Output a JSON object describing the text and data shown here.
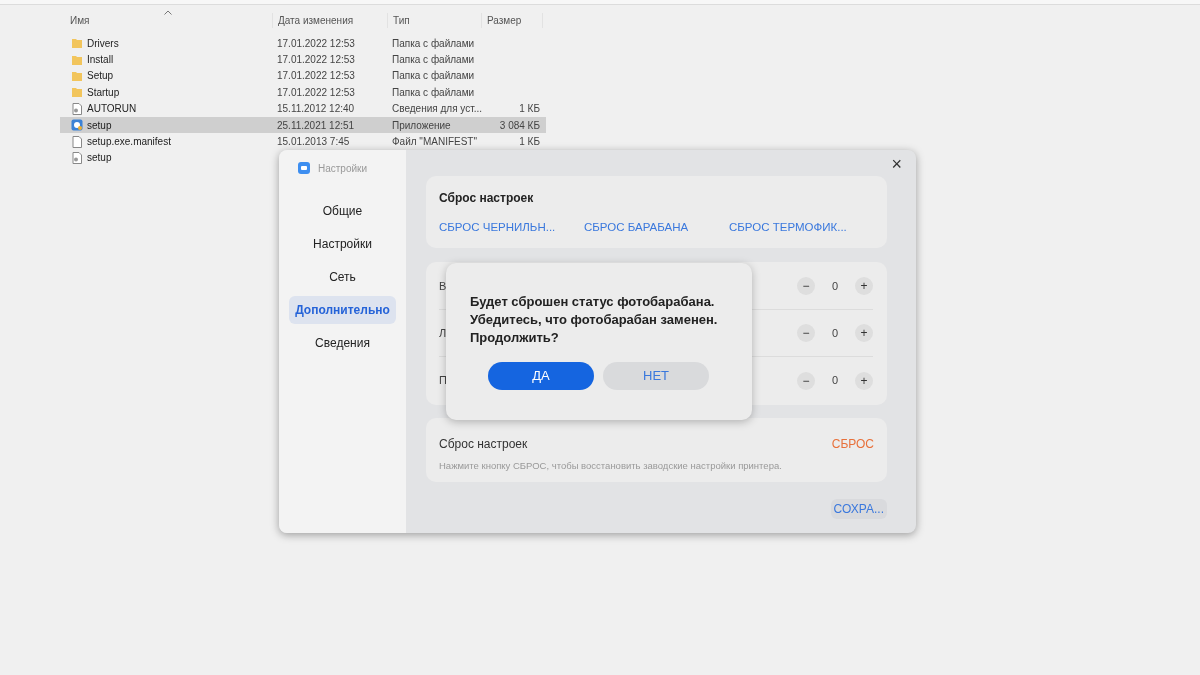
{
  "explorer": {
    "columns": [
      "Имя",
      "Дата изменения",
      "Тип",
      "Размер"
    ],
    "rows": [
      {
        "kind": "folder",
        "name": "Drivers",
        "date": "17.01.2022 12:53",
        "type": "Папка с файлами",
        "size": "",
        "selected": false
      },
      {
        "kind": "folder",
        "name": "Install",
        "date": "17.01.2022 12:53",
        "type": "Папка с файлами",
        "size": "",
        "selected": false
      },
      {
        "kind": "folder",
        "name": "Setup",
        "date": "17.01.2022 12:53",
        "type": "Папка с файлами",
        "size": "",
        "selected": false
      },
      {
        "kind": "folder",
        "name": "Startup",
        "date": "17.01.2022 12:53",
        "type": "Папка с файлами",
        "size": "",
        "selected": false
      },
      {
        "kind": "config",
        "name": "AUTORUN",
        "date": "15.11.2012 12:40",
        "type": "Сведения для уст...",
        "size": "1 КБ",
        "selected": false
      },
      {
        "kind": "app",
        "name": "setup",
        "date": "25.11.2021 12:51",
        "type": "Приложение",
        "size": "3 084 КБ",
        "selected": true
      },
      {
        "kind": "file",
        "name": "setup.exe.manifest",
        "date": "15.01.2013 7:45",
        "type": "Файл \"MANIFEST\"",
        "size": "1 КБ",
        "selected": false
      },
      {
        "kind": "config",
        "name": "setup",
        "selected": false
      }
    ]
  },
  "settings_window": {
    "title": "Настройки",
    "close": "×",
    "sidebar": [
      {
        "label": "Общие",
        "selected": false
      },
      {
        "label": "Настройки",
        "selected": false
      },
      {
        "label": "Сеть",
        "selected": false
      },
      {
        "label": "Дополнительно",
        "selected": true
      },
      {
        "label": "Сведения",
        "selected": false
      }
    ],
    "reset_card": {
      "title": "Сброс настроек",
      "links": [
        "СБРОС ЧЕРНИЛЬН...",
        "СБРОС БАРАБАНА",
        "СБРОС ТЕРМОФИК..."
      ]
    },
    "counters": [
      {
        "label": "В",
        "minus": "−",
        "value": "0",
        "plus": "+"
      },
      {
        "label": "Л",
        "minus": "−",
        "value": "0",
        "plus": "+"
      },
      {
        "label": "П",
        "minus": "−",
        "value": "0",
        "plus": "+"
      }
    ],
    "factory_reset": {
      "title": "Сброс настроек",
      "action": "СБРОС",
      "description": "Нажмите кнопку СБРОС, чтобы восстановить заводские настройки принтера."
    },
    "save": "СОХРА..."
  },
  "confirm_dialog": {
    "lines": [
      "Будет сброшен статус фотобарабана.",
      "Убедитесь, что фотобарабан заменен.",
      "Продолжить?"
    ],
    "yes": "ДА",
    "no": "НЕТ"
  }
}
